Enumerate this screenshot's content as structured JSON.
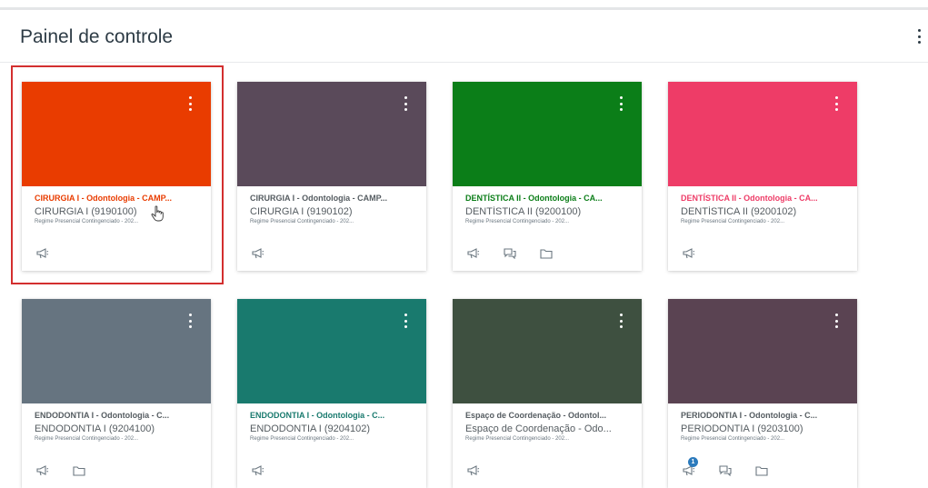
{
  "header": {
    "title": "Painel de controle",
    "menu_icon": "kebab-menu-icon"
  },
  "cards": [
    {
      "color": "#e93c00",
      "title_color": "#e93c00",
      "title": "CIRURGIA I - Odontologia - CAMP...",
      "subtitle": "CIRURGIA I (9190100)",
      "term": "Regime Presencial Contingenciado - 202...",
      "icons": [
        "announcement-icon"
      ],
      "badge": ""
    },
    {
      "color": "#5a4a5a",
      "title_color": "#555c61",
      "title": "CIRURGIA I - Odontologia - CAMP...",
      "subtitle": "CIRURGIA I (9190102)",
      "term": "Regime Presencial Contingenciado - 202...",
      "icons": [
        "announcement-icon"
      ],
      "badge": ""
    },
    {
      "color": "#0b7e18",
      "title_color": "#0b7e18",
      "title": "DENTÍSTICA II - Odontologia - CA...",
      "subtitle": "DENTÍSTICA II (9200100)",
      "term": "Regime Presencial Contingenciado - 202...",
      "icons": [
        "announcement-icon",
        "discussion-icon",
        "folder-icon"
      ],
      "badge": ""
    },
    {
      "color": "#ee3c67",
      "title_color": "#ee3c67",
      "title": "DENTÍSTICA II - Odontologia - CA...",
      "subtitle": "DENTÍSTICA II (9200102)",
      "term": "Regime Presencial Contingenciado - 202...",
      "icons": [
        "announcement-icon"
      ],
      "badge": ""
    },
    {
      "color": "#667480",
      "title_color": "#555c61",
      "title": "ENDODONTIA I - Odontologia - C...",
      "subtitle": "ENDODONTIA I (9204100)",
      "term": "Regime Presencial Contingenciado - 202...",
      "icons": [
        "announcement-icon",
        "folder-icon"
      ],
      "badge": ""
    },
    {
      "color": "#197a6e",
      "title_color": "#197a6e",
      "title": "ENDODONTIA I - Odontologia - C...",
      "subtitle": "ENDODONTIA I (9204102)",
      "term": "Regime Presencial Contingenciado - 202...",
      "icons": [
        "announcement-icon"
      ],
      "badge": ""
    },
    {
      "color": "#3e5040",
      "title_color": "#555c61",
      "title": "Espaço de Coordenação - Odontol...",
      "subtitle": "Espaço de Coordenação - Odo...",
      "term": "Regime Presencial Contingenciado - 202...",
      "icons": [
        "announcement-icon"
      ],
      "badge": ""
    },
    {
      "color": "#5a4352",
      "title_color": "#555c61",
      "title": "PERIODONTIA I - Odontologia - C...",
      "subtitle": "PERIODONTIA I (9203100)",
      "term": "Regime Presencial Contingenciado - 202...",
      "icons": [
        "announcement-icon",
        "discussion-icon",
        "folder-icon"
      ],
      "badge": "1"
    }
  ]
}
